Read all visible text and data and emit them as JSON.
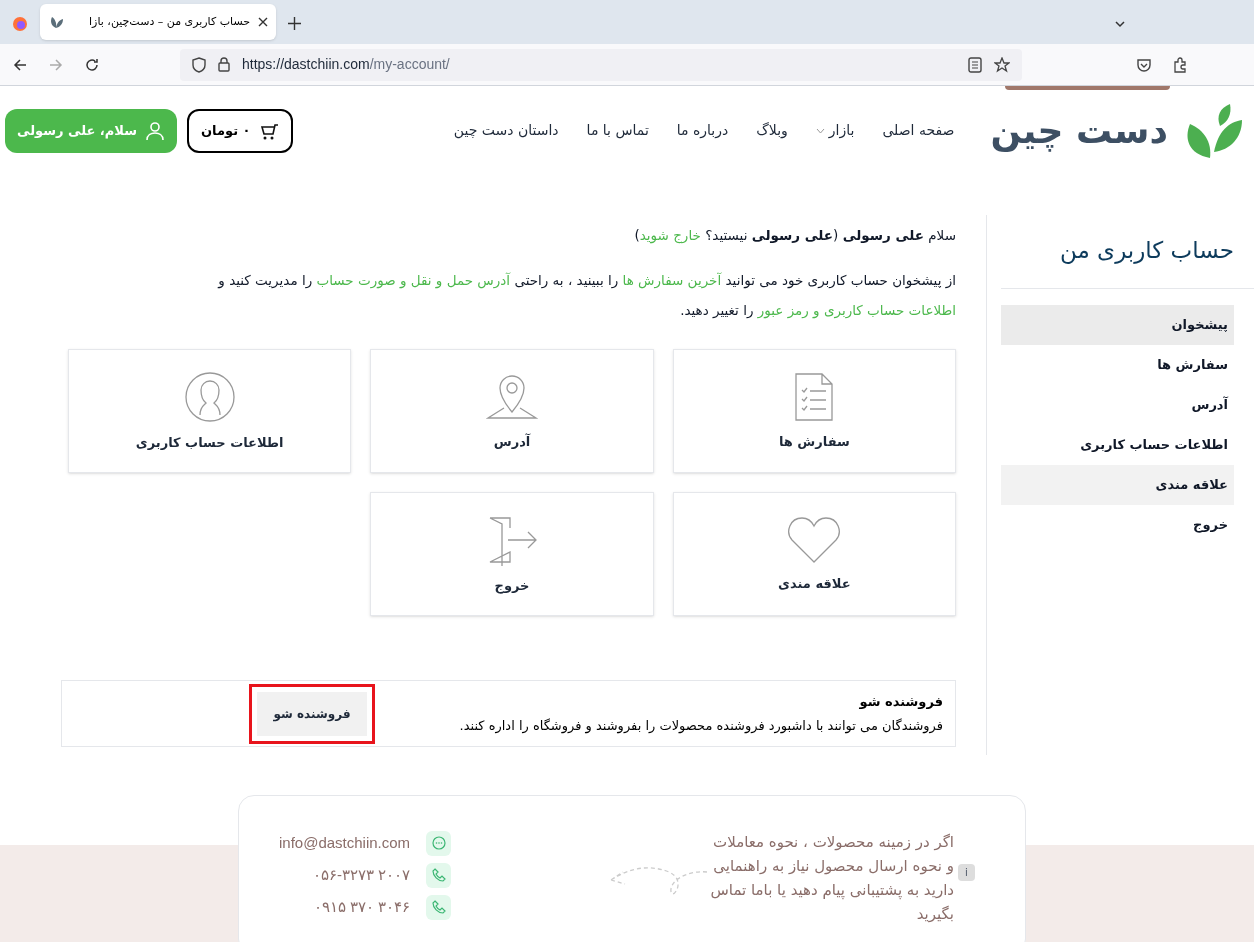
{
  "browser": {
    "tab_title": "حساب کاربری من – دست‌چین، بازا",
    "url_host": "https://dastchiin.com",
    "url_path": "/my-account/"
  },
  "header": {
    "logo_text": "دست چین",
    "nav": [
      {
        "label": "صفحه اصلی",
        "dropdown": false
      },
      {
        "label": "بازار",
        "dropdown": true
      },
      {
        "label": "وبلاگ",
        "dropdown": false
      },
      {
        "label": "درباره ما",
        "dropdown": false
      },
      {
        "label": "تماس با ما",
        "dropdown": false
      },
      {
        "label": "داستان دست چین",
        "dropdown": false
      }
    ],
    "cart_total": "۰ تومان",
    "greeting": "سلام، علی رسولی"
  },
  "sidebar": {
    "title": "حساب کاربری من",
    "items": [
      {
        "label": "پیشخوان",
        "selected": true,
        "hovered": false
      },
      {
        "label": "سفارش ها",
        "selected": false,
        "hovered": false
      },
      {
        "label": "آدرس",
        "selected": false,
        "hovered": false
      },
      {
        "label": "اطلاعات حساب کاربری",
        "selected": false,
        "hovered": false
      },
      {
        "label": "علاقه مندی",
        "selected": false,
        "hovered": true
      },
      {
        "label": "خروج",
        "selected": false,
        "hovered": false
      }
    ]
  },
  "welcome": [
    {
      "kind": "text",
      "text": "سلام "
    },
    {
      "kind": "bold",
      "text": "علی رسولی"
    },
    {
      "kind": "text",
      "text": " ("
    },
    {
      "kind": "bold",
      "text": "علی رسولی"
    },
    {
      "kind": "text",
      "text": " نیستید؟ "
    },
    {
      "kind": "link",
      "text": "خارج شوید"
    },
    {
      "kind": "text",
      "text": ")"
    }
  ],
  "intro": [
    {
      "kind": "text",
      "text": "از پیشخوان حساب کاربری خود می توانید "
    },
    {
      "kind": "link",
      "text": "آخرین سفارش ها"
    },
    {
      "kind": "text",
      "text": " را ببینید ، به راحتی "
    },
    {
      "kind": "link",
      "text": "آدرس حمل و نقل و صورت حساب"
    },
    {
      "kind": "text",
      "text": " را مدیریت کنید و "
    },
    {
      "kind": "link",
      "text": "اطلاعات حساب کاربری و رمز عبور"
    },
    {
      "kind": "text",
      "text": " را تغییر دهید."
    }
  ],
  "cards": [
    {
      "kind": "orders",
      "label": "سفارش ها"
    },
    {
      "kind": "address",
      "label": "آدرس"
    },
    {
      "kind": "account",
      "label": "اطلاعات حساب کاربری"
    },
    {
      "kind": "wishlist",
      "label": "علاقه مندی"
    },
    {
      "kind": "logout",
      "label": "خروج"
    }
  ],
  "seller": {
    "title": "فروشنده شو",
    "description": "فروشندگان می توانند با داشبورد فروشنده محصولات را بفروشند و فروشگاه را اداره کنند.",
    "button": "فروشنده شو",
    "highlighted": true
  },
  "support": {
    "message": "اگر در زمینه محصولات ، نحوه معاملات و نحوه ارسال محصول نیاز به راهنمایی دارید به پشتیبانی پیام دهید یا باما تماس بگیرید",
    "info_badge": "i",
    "contacts": [
      {
        "kind": "chat",
        "text": "info@dastchiin.com"
      },
      {
        "kind": "phone",
        "text": "۰۵۶-۳۲۷۳ ۲۰۰۷"
      },
      {
        "kind": "phone",
        "text": "۰۹۱۵ ۳۷۰ ۳۰۴۶"
      }
    ]
  }
}
